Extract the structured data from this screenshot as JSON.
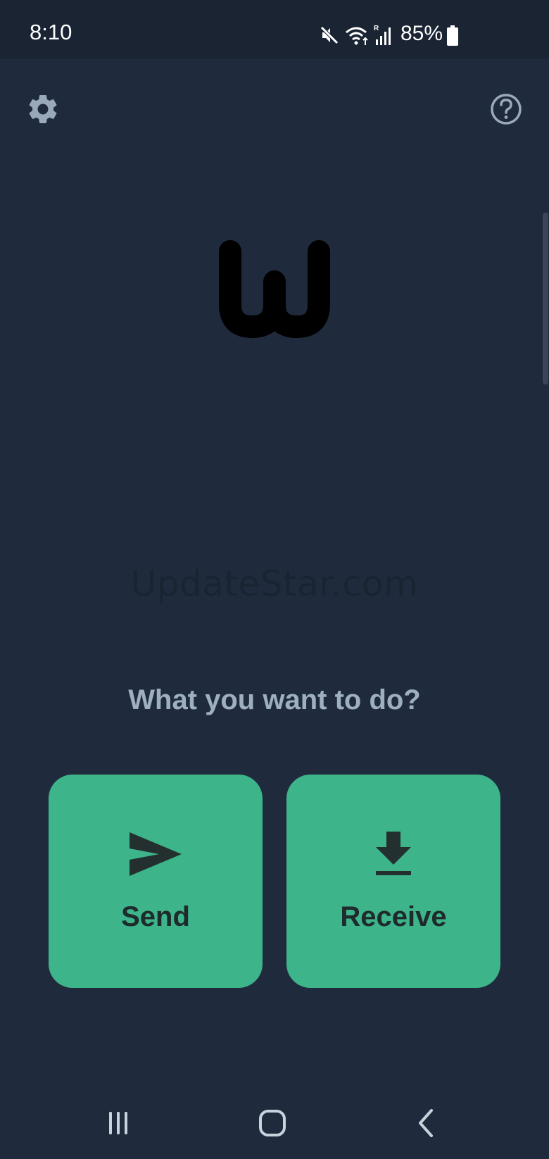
{
  "status_bar": {
    "time": "8:10",
    "battery": "85%",
    "icons": [
      "mute-icon",
      "wifi-icon",
      "signal-icon",
      "battery-icon"
    ]
  },
  "toolbar": {
    "settings_icon": "gear-icon",
    "help_icon": "help-circle-icon"
  },
  "logo": {
    "icon": "w-logo-icon"
  },
  "watermark": "UpdateStar.com",
  "main": {
    "question": "What you want to do?",
    "actions": [
      {
        "label": "Send",
        "icon": "send-icon"
      },
      {
        "label": "Receive",
        "icon": "download-icon"
      }
    ]
  },
  "nav_bar": {
    "buttons": [
      "recent-apps-icon",
      "home-icon",
      "back-icon"
    ]
  },
  "colors": {
    "background": "#1f2b3c",
    "status_bar": "#1a2433",
    "accent": "#3db48a",
    "question_text": "#9eafc0",
    "card_text": "#1e2a2c"
  }
}
